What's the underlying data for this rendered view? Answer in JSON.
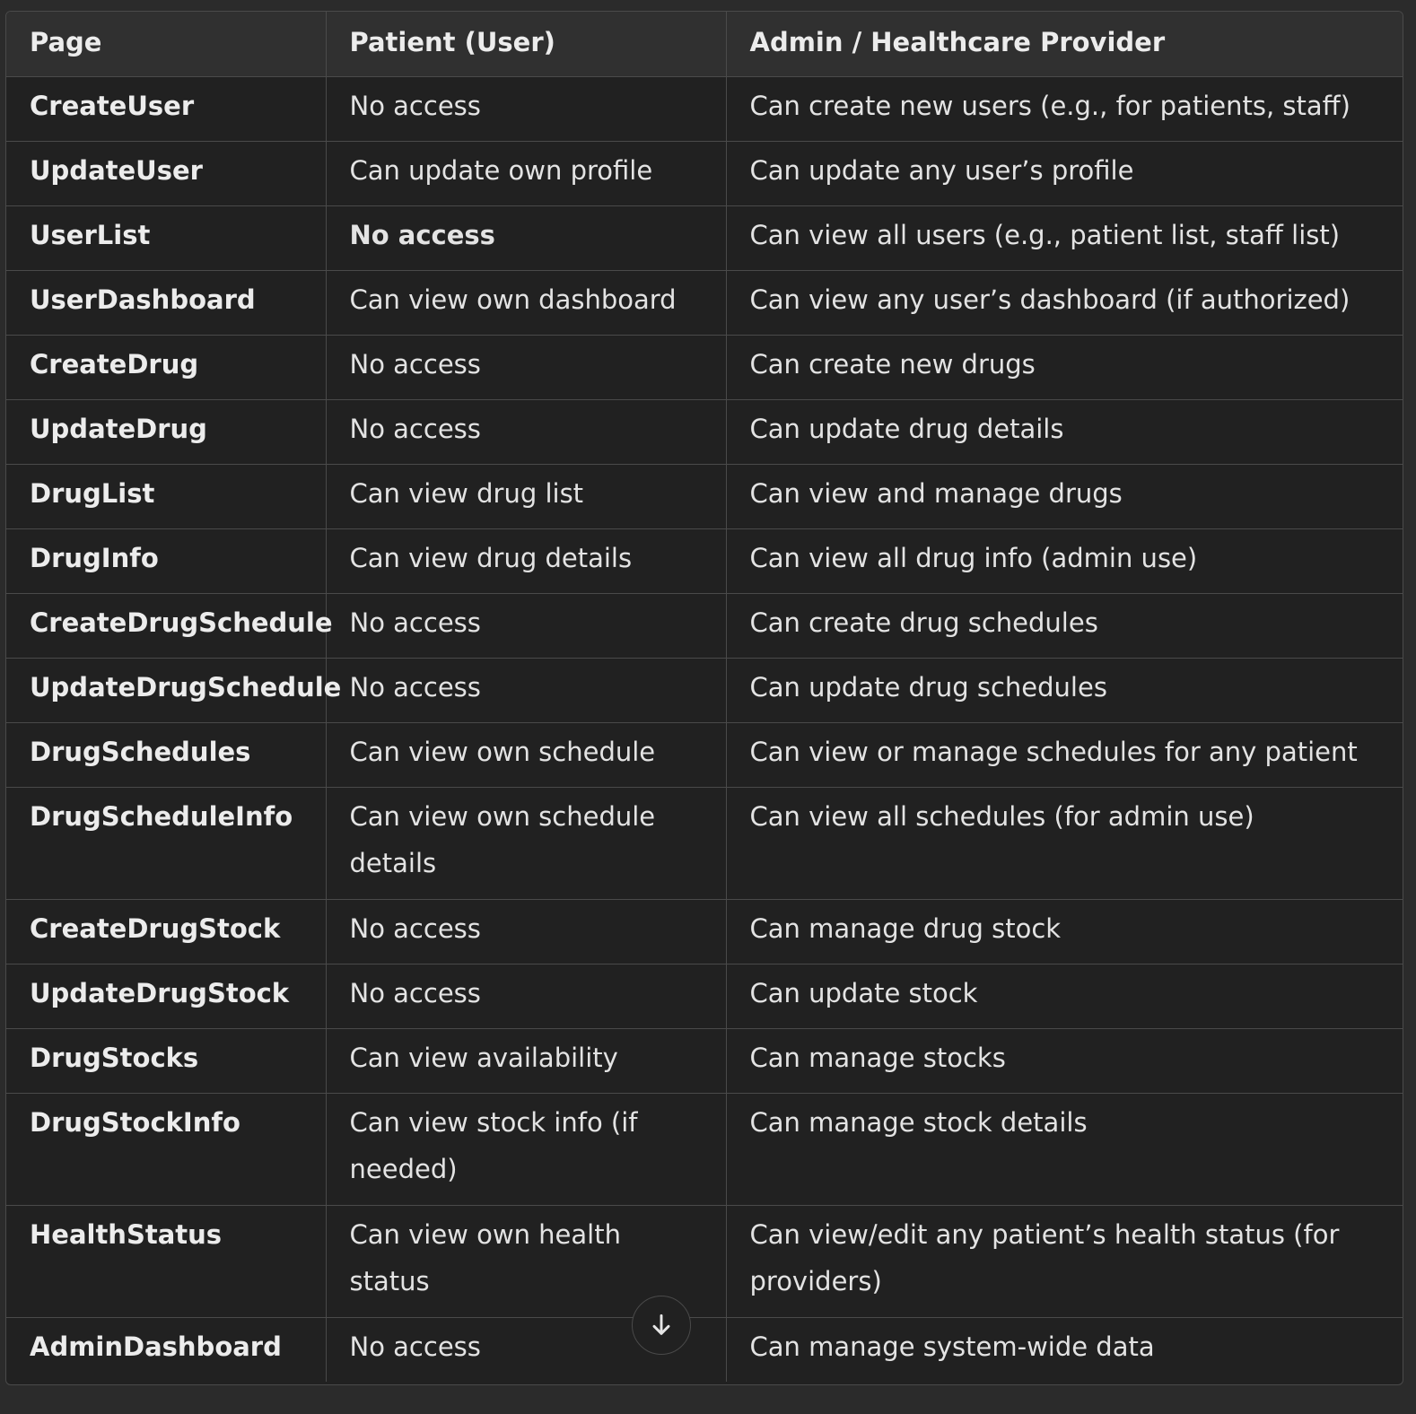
{
  "table": {
    "headers": [
      "Page",
      "Patient (User)",
      "Admin / Healthcare Provider"
    ],
    "rows": [
      {
        "page": "CreateUser",
        "patient": "No access",
        "admin": "Can create new users (e.g., for patients, staff)"
      },
      {
        "page": "UpdateUser",
        "patient": "Can update own profile",
        "admin": "Can update any user’s profile"
      },
      {
        "page": "UserList",
        "patient": "No access",
        "admin": "Can view all users (e.g., patient list, staff list)"
      },
      {
        "page": "UserDashboard",
        "patient": "Can view own dashboard",
        "admin": "Can view any user’s dashboard (if authorized)"
      },
      {
        "page": "CreateDrug",
        "patient": "No access",
        "admin": "Can create new drugs"
      },
      {
        "page": "UpdateDrug",
        "patient": "No access",
        "admin": "Can update drug details"
      },
      {
        "page": "DrugList",
        "patient": "Can view drug list",
        "admin": "Can view and manage drugs"
      },
      {
        "page": "DrugInfo",
        "patient": "Can view drug details",
        "admin": "Can view all drug info (admin use)"
      },
      {
        "page": "CreateDrugSchedule",
        "patient": "No access",
        "admin": "Can create drug schedules"
      },
      {
        "page": "UpdateDrugSchedule",
        "patient": "No access",
        "admin": "Can update drug schedules"
      },
      {
        "page": "DrugSchedules",
        "patient": "Can view own schedule",
        "admin": "Can view or manage schedules for any patient"
      },
      {
        "page": "DrugScheduleInfo",
        "patient": "Can view own schedule details",
        "admin": "Can view all schedules (for admin use)"
      },
      {
        "page": "CreateDrugStock",
        "patient": "No access",
        "admin": "Can manage drug stock"
      },
      {
        "page": "UpdateDrugStock",
        "patient": "No access",
        "admin": "Can update stock"
      },
      {
        "page": "DrugStocks",
        "patient": "Can view availability",
        "admin": "Can manage stocks"
      },
      {
        "page": "DrugStockInfo",
        "patient": "Can view stock info (if needed)",
        "admin": "Can manage stock details"
      },
      {
        "page": "HealthStatus",
        "patient": "Can view own health status",
        "admin": "Can view/edit any patient’s health status (for providers)"
      },
      {
        "page": "AdminDashboard",
        "patient": "No access",
        "admin": "Can manage system-wide data"
      }
    ]
  },
  "scroll_button": {
    "icon": "arrow-down-icon"
  }
}
